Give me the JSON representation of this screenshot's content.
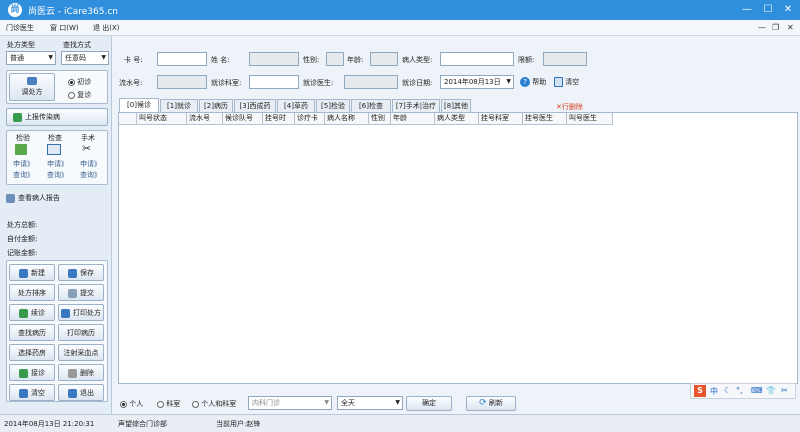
{
  "titlebar": {
    "logo": "尚",
    "title": "尚医云 - iCare365.cn",
    "minimize": "—",
    "maximize": "☐",
    "close": "✕"
  },
  "menu": {
    "items": [
      "门诊医生",
      "窗 口(W)",
      "退 出(X)"
    ],
    "mdi_min": "—",
    "mdi_restore": "❐",
    "mdi_close": "✕"
  },
  "left": {
    "rx_type_label": "处方类型",
    "find_label": "查找方式",
    "rx_type_value": "普通",
    "find_value": "任意码",
    "adjust_rx": "调处方",
    "first_visit": "初诊",
    "revisit": "复诊",
    "upload_infection": "上报传染病",
    "exam_labels": [
      "检验",
      "检查",
      "手术"
    ],
    "request": "申请》",
    "query": "查询》",
    "view_report": "查看病人报告",
    "rx_total": "处方总额:",
    "self_pay": "自付金额:",
    "account": "记账金额:",
    "buttons": [
      [
        "新建",
        "保存"
      ],
      [
        "处方排序",
        "提交"
      ],
      [
        "续诊",
        "打印处方"
      ],
      [
        "查找病历",
        "打印病历"
      ],
      [
        "选择药房",
        "注射采血点"
      ],
      [
        "接诊",
        "删除"
      ],
      [
        "清空",
        "退出"
      ]
    ]
  },
  "form": {
    "card_label": "卡 号:",
    "name_label": "姓 名:",
    "sex_label": "性别:",
    "age_label": "年龄:",
    "patient_type_label": "病人类型:",
    "limit_label": "限额:",
    "serial_label": "流水号:",
    "dept_label": "就诊科室:",
    "doctor_label": "就诊医生:",
    "date_label": "就诊日期:",
    "date_value": "2014年08月13日",
    "help": "帮助",
    "clear": "清空"
  },
  "tabs": [
    "[0]候诊",
    "[1]就诊",
    "[2]病历",
    "[3]西成药",
    "[4]草药",
    "[5]检验",
    "[6]检查",
    "[7]手术|治疗",
    "[8]其他"
  ],
  "row_delete": "行删除",
  "grid": {
    "columns": [
      "叫号状态",
      "流水号",
      "候诊队号",
      "挂号时",
      "诊疗卡",
      "病人名称",
      "性别",
      "年龄",
      "病人类型",
      "挂号科室",
      "挂号医生",
      "叫号医生"
    ]
  },
  "bottom": {
    "opt_person": "个人",
    "opt_dept": "科室",
    "opt_both": "个人和科室",
    "dept_select": "内科门诊",
    "range_select": "全天",
    "confirm": "确定",
    "refresh": "刷新"
  },
  "status": {
    "datetime": "2014年08月13日 21:20:31",
    "dept": "声望综合门诊部",
    "user": "当前用户:赵锋"
  },
  "ime": {
    "s": "S",
    "zh": "中",
    "items": [
      "☾",
      "°,",
      "⌨",
      "👕",
      "✂"
    ]
  }
}
